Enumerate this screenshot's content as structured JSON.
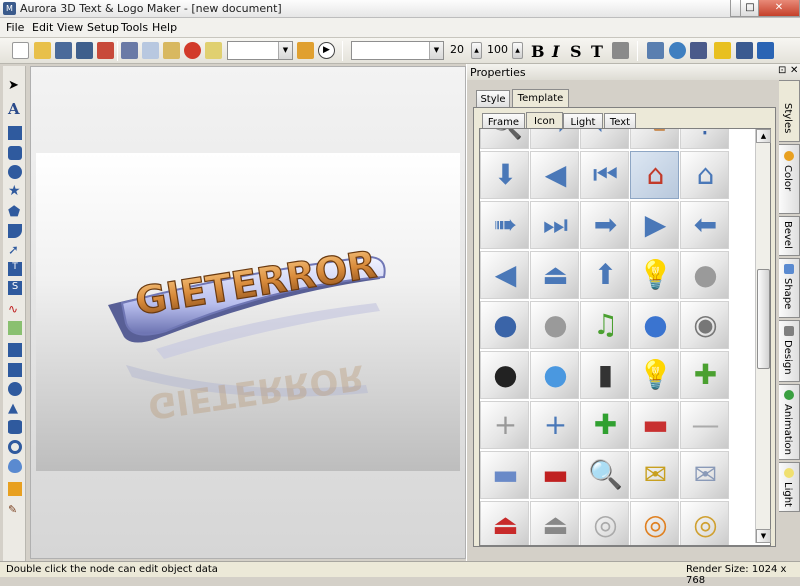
{
  "window": {
    "title": "Aurora 3D Text & Logo Maker - [new document]"
  },
  "menu": [
    "File",
    "Edit",
    "View",
    "Setup",
    "Tools",
    "Help"
  ],
  "toolbar": {
    "font_size": "20",
    "zoom": "100"
  },
  "canvas": {
    "logo_text": "GIETERROR"
  },
  "properties": {
    "title": "Properties",
    "tabs": [
      "Style",
      "Template"
    ],
    "subtabs": [
      "Frame",
      "Icon",
      "Light",
      "Text"
    ]
  },
  "side_tabs": [
    "Styles",
    "Color",
    "Bevel",
    "Shape",
    "Design",
    "Animation",
    "Light"
  ],
  "icons": [
    [
      "magnifier-icon",
      "arrow-right-icon",
      "arrow-left-icon",
      "hand-icon",
      "question-icon"
    ],
    [
      "arrow-down-icon",
      "speaker-left-icon",
      "skip-back-icon",
      "home-red-icon",
      "home-blue-icon"
    ],
    [
      "arrow-right-dot-icon",
      "skip-forward-icon",
      "arrow-right-icon",
      "triangle-right-icon",
      "arrow-left-icon"
    ],
    [
      "triangle-left-icon",
      "person-up-icon",
      "arrow-up-icon",
      "bulb-icon",
      "user-grey-icon"
    ],
    [
      "user-blue-icon",
      "user-grey-icon",
      "music-note-icon",
      "bluetooth-icon",
      "speaker-icon"
    ],
    [
      "penguin-icon",
      "chat-icon",
      "traffic-light-icon",
      "bulb-icon",
      "plus-green-icon"
    ],
    [
      "plus-thin-icon",
      "plus-blue-icon",
      "plus-green-big-icon",
      "minus-red-icon",
      "minus-grey-icon"
    ],
    [
      "minus-blue-icon",
      "minus-red-pill-icon",
      "magnifier-icon",
      "mail-star-icon",
      "mail-icon"
    ],
    [
      "eject-red-icon",
      "eject-grey-icon",
      "disc-icon",
      "disc-fire-icon",
      "disc-gold-icon"
    ]
  ],
  "status": {
    "left": "Double click the node can edit object data",
    "right": "Render Size: 1024 x 768"
  }
}
